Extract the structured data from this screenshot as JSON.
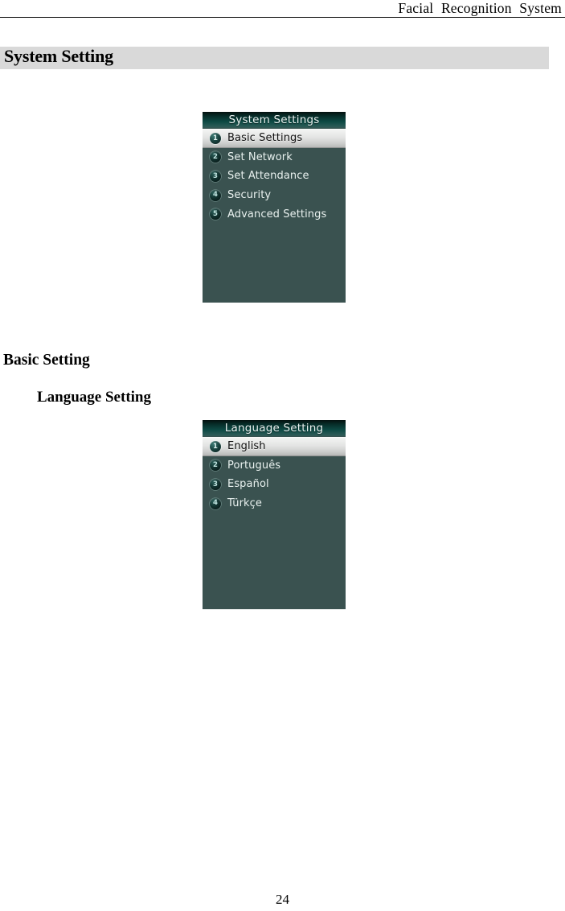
{
  "header": {
    "running_title": "Facial  Recognition  System"
  },
  "section": {
    "band_heading": "System Setting",
    "sub_heading": "Basic Setting",
    "sub_sub_heading": "Language Setting"
  },
  "panels": [
    {
      "id": "system-settings",
      "title": "System Settings",
      "items": [
        {
          "num": "1",
          "label": "Basic Settings",
          "selected": true
        },
        {
          "num": "2",
          "label": "Set Network",
          "selected": false
        },
        {
          "num": "3",
          "label": "Set Attendance",
          "selected": false
        },
        {
          "num": "4",
          "label": "Security",
          "selected": false
        },
        {
          "num": "5",
          "label": "Advanced Settings",
          "selected": false
        }
      ]
    },
    {
      "id": "language-setting",
      "title": "Language Setting",
      "items": [
        {
          "num": "1",
          "label": "English",
          "selected": true
        },
        {
          "num": "2",
          "label": "Português",
          "selected": false
        },
        {
          "num": "3",
          "label": "Español",
          "selected": false
        },
        {
          "num": "4",
          "label": "Türkçe",
          "selected": false
        }
      ]
    }
  ],
  "footer": {
    "page_number": "24"
  },
  "colors": {
    "panel_background": "#3a5250",
    "panel_title_text": "#e8f2f0",
    "selected_row_text": "#101010",
    "band_background": "#d9d9d9"
  }
}
